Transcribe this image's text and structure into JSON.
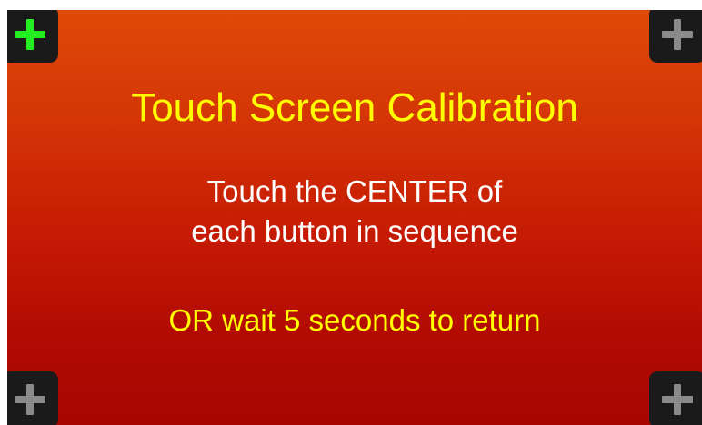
{
  "title": "Touch Screen Calibration",
  "instructions": {
    "line1": "Touch the CENTER of",
    "line2": "each button in sequence"
  },
  "timeout_text": "OR wait 5 seconds to return",
  "calibration_points": [
    {
      "id": "top-left",
      "icon": "plus-icon",
      "active": true
    },
    {
      "id": "top-right",
      "icon": "plus-icon",
      "active": false
    },
    {
      "id": "bottom-left",
      "icon": "plus-icon",
      "active": false
    },
    {
      "id": "bottom-right",
      "icon": "plus-icon",
      "active": false
    }
  ],
  "colors": {
    "background_top": "#de4a08",
    "background_bottom": "#a80503",
    "title": "#ffff00",
    "instructions": "#ffffff",
    "timeout_text": "#ffff00",
    "button_bg": "#1a1a1a",
    "active_plus": "#22ee22",
    "inactive_plus": "#8a8a8a"
  }
}
